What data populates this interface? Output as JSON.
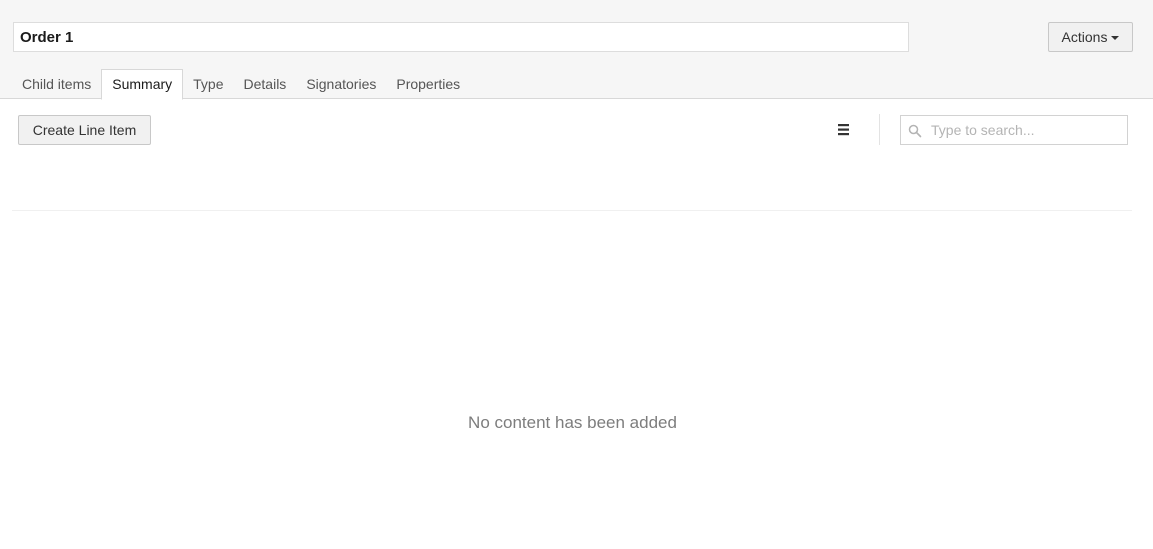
{
  "header": {
    "item_name": "Order 1",
    "actions_label": "Actions"
  },
  "tabs": [
    {
      "label": "Child items",
      "active": false
    },
    {
      "label": "Summary",
      "active": true
    },
    {
      "label": "Type",
      "active": false
    },
    {
      "label": "Details",
      "active": false
    },
    {
      "label": "Signatories",
      "active": false
    },
    {
      "label": "Properties",
      "active": false
    }
  ],
  "toolbar": {
    "create_label": "Create Line Item",
    "view_icon": "list-view-icon",
    "search_placeholder": "Type to search...",
    "search_icon": "search-icon"
  },
  "content": {
    "empty_message": "No content has been added"
  }
}
